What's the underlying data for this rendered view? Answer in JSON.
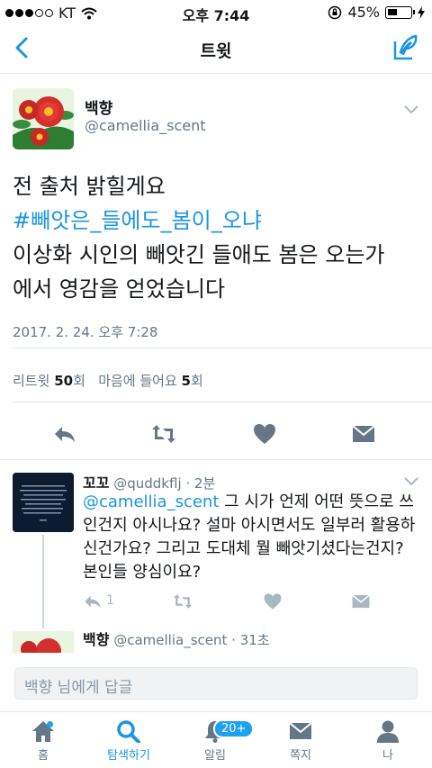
{
  "status_bar": {
    "carrier": "KT",
    "time": "오후 7:44",
    "battery": "45%",
    "battery_level": 0.45
  },
  "nav": {
    "title": "트윗"
  },
  "tweet": {
    "author_name": "백향",
    "author_handle": "@camellia_scent",
    "line1": "전 출처 밝힐게요",
    "hashtag": "#빼앗은_들에도_봄이_오냐",
    "line2": "이상화 시인의 빼앗긴 들애도 봄은 오는가",
    "line3": "에서 영감을 얻었습니다",
    "timestamp": "2017. 2. 24. 오후 7:28",
    "stats": {
      "retweet_label": "리트윗",
      "retweet_count": "50",
      "retweet_unit": "회",
      "like_label": "마음에 들어요",
      "like_count": "5",
      "like_unit": "회"
    }
  },
  "reply": {
    "author_name": "꼬꼬",
    "author_handle": "@quddkflj",
    "time": "· 2분",
    "mention": "@camellia_scent",
    "text": " 그 시가 언제 어떤 뜻으로 쓰인건지 아시나요? 설마 아시면서도 일부러 활용하신건가요? 그리고 도대체 뭘 빼앗기셨다는건지? 본인들 양심이요?",
    "reply_count": "1"
  },
  "reply2": {
    "author_name": "백향",
    "author_handle": "@camellia_scent",
    "time": "· 31초"
  },
  "reply_box": {
    "placeholder": "백향 님에게 답글"
  },
  "tab_bar": {
    "items": [
      {
        "label": "홈"
      },
      {
        "label": "탐색하기"
      },
      {
        "label": "알림",
        "badge": "20+"
      },
      {
        "label": "쪽지"
      },
      {
        "label": "나"
      }
    ]
  },
  "colors": {
    "accent": "#1b95e0",
    "muted": "#657786",
    "action_icon": "#657786"
  }
}
